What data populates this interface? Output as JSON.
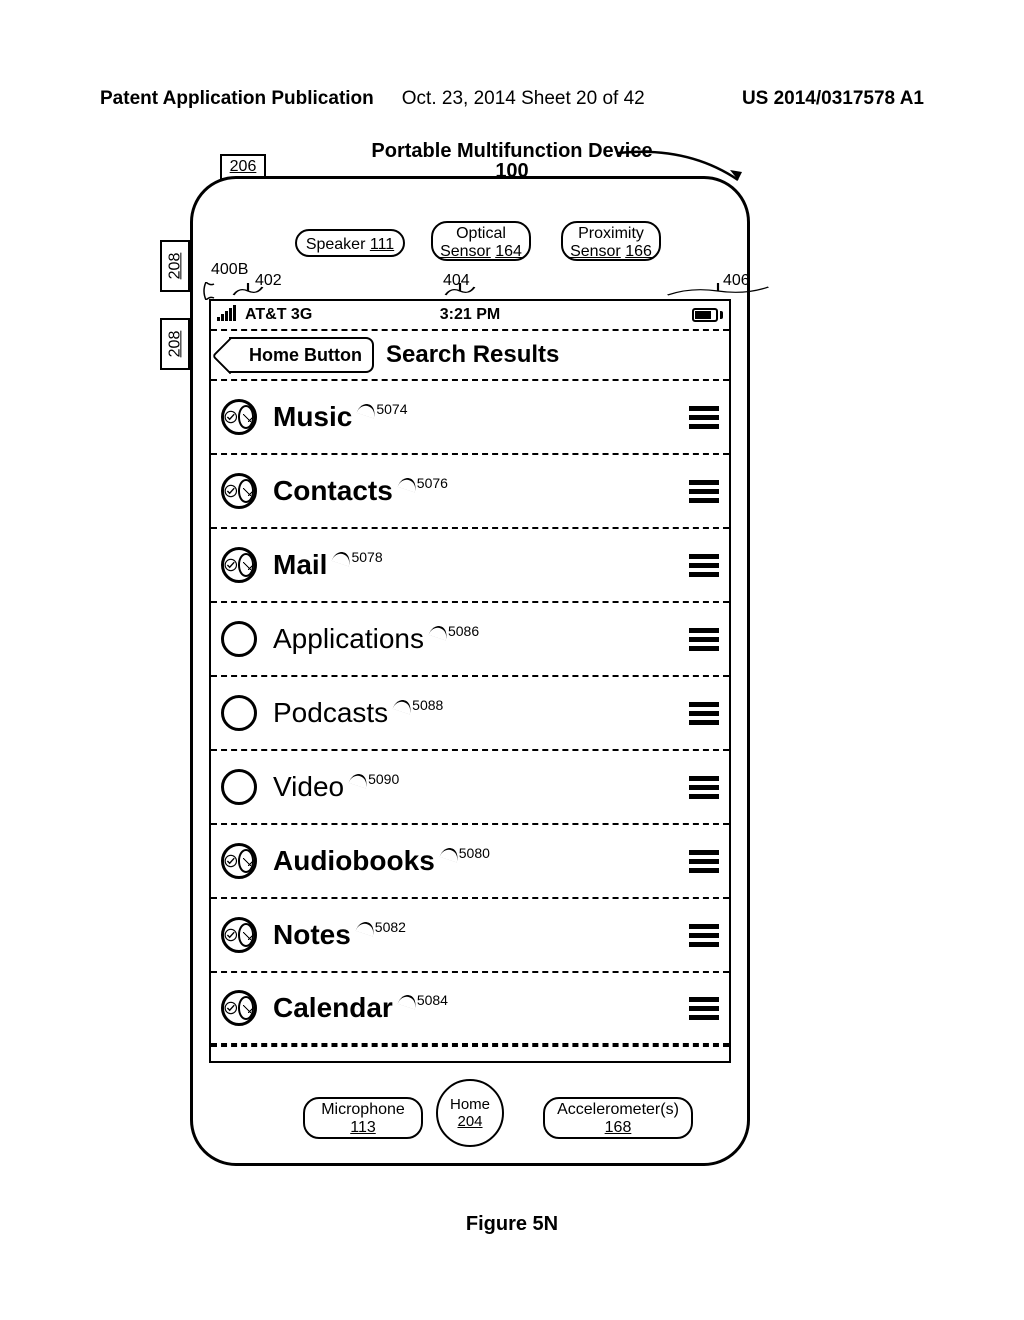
{
  "header": {
    "left": "Patent Application Publication",
    "center": "Oct. 23, 2014  Sheet 20 of 42",
    "right": "US 2014/0317578 A1"
  },
  "device_title": "Portable Multifunction Device",
  "device_title_num": "100",
  "side_labels": {
    "l206": "206",
    "l208a": "208",
    "l208b": "208"
  },
  "top_components": {
    "speaker": {
      "label": "Speaker",
      "num": "111"
    },
    "optical": {
      "label_line1": "Optical",
      "label_line2": "Sensor",
      "num": "164"
    },
    "proximity": {
      "label_line1": "Proximity",
      "label_line2": "Sensor",
      "num": "166"
    }
  },
  "status_refs": {
    "r400b": "400B",
    "r402": "402",
    "r404": "404",
    "r406": "406"
  },
  "status_bar": {
    "carrier": "AT&T 3G",
    "time": "3:21 PM"
  },
  "nav": {
    "back": "Home Button",
    "title": "Search Results"
  },
  "list": [
    {
      "label": "Music",
      "ref": "5074",
      "checked": true,
      "bold": true
    },
    {
      "label": "Contacts",
      "ref": "5076",
      "checked": true,
      "bold": true
    },
    {
      "label": "Mail",
      "ref": "5078",
      "checked": true,
      "bold": true
    },
    {
      "label": "Applications",
      "ref": "5086",
      "checked": false,
      "bold": false
    },
    {
      "label": "Podcasts",
      "ref": "5088",
      "checked": false,
      "bold": false
    },
    {
      "label": "Video",
      "ref": "5090",
      "checked": false,
      "bold": false
    },
    {
      "label": "Audiobooks",
      "ref": "5080",
      "checked": true,
      "bold": true
    },
    {
      "label": "Notes",
      "ref": "5082",
      "checked": true,
      "bold": true
    },
    {
      "label": "Calendar",
      "ref": "5084",
      "checked": true,
      "bold": true
    }
  ],
  "bottom_components": {
    "mic": {
      "label": "Microphone",
      "num": "113"
    },
    "home": {
      "label": "Home",
      "num": "204"
    },
    "accel": {
      "label": "Accelerometer(s)",
      "num": "168"
    }
  },
  "figure_caption": "Figure 5N"
}
